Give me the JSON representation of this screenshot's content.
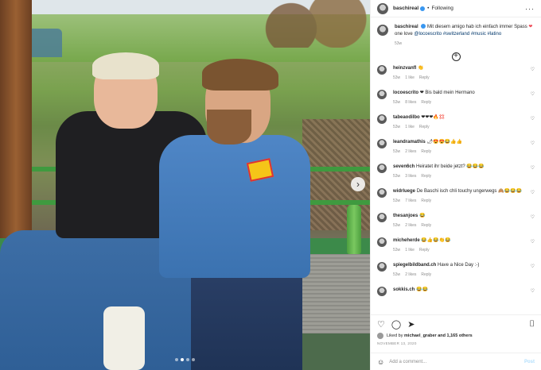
{
  "header": {
    "username": "baschireal",
    "separator": "•",
    "follow_status": "Following",
    "more_icon": "···"
  },
  "caption": {
    "username": "baschireal",
    "text_1": "Mit diesem amigo hab ich einfach immer Spass",
    "heart": "❤",
    "text_2": "one love",
    "mention": "@locoescrito",
    "hashtags": "#switzerland #music #latino",
    "time": "53w"
  },
  "load_more_icon": "+",
  "comments": [
    {
      "user": "heinzvanfl",
      "text": "👏",
      "time": "53w",
      "likes": "1 like",
      "reply": "Reply"
    },
    {
      "user": "locoescrito",
      "text": "❤ Bis bald mein Hermano",
      "time": "53w",
      "likes": "8 likes",
      "reply": "Reply"
    },
    {
      "user": "tabeaodilbo",
      "text": "❤❤❤🔥💢",
      "time": "53w",
      "likes": "1 like",
      "reply": "Reply"
    },
    {
      "user": "leandramathis",
      "text": "🌶😍😍😂👍👍",
      "time": "53w",
      "likes": "2 likes",
      "reply": "Reply"
    },
    {
      "user": "seven6ch",
      "text": "Heiratet ihr beide jetzt? 😂😂😂",
      "time": "53w",
      "likes": "3 likes",
      "reply": "Reply"
    },
    {
      "user": "widrluege",
      "text": "De Baschi isch chli touchy ungerwegs 🙈😂😂😂",
      "time": "53w",
      "likes": "7 likes",
      "reply": "Reply"
    },
    {
      "user": "thesanjoes",
      "text": "😂",
      "time": "53w",
      "likes": "2 likes",
      "reply": "Reply"
    },
    {
      "user": "micheherde",
      "text": "😂👍😂👏😂",
      "time": "53w",
      "likes": "1 like",
      "reply": "Reply"
    },
    {
      "user": "spiegelbildband.ch",
      "text": "Have a Nice Day :-)",
      "time": "53w",
      "likes": "2 likes",
      "reply": "Reply"
    },
    {
      "user": "sokkis.ch",
      "text": "😂😂",
      "time": "",
      "likes": "",
      "reply": ""
    }
  ],
  "comment_like_icon": "♡",
  "actions": {
    "like_icon": "♡",
    "comment_icon": "◯",
    "share_icon": "➤",
    "save_icon": "⌷",
    "liked_by_prefix": "Liked by",
    "liked_by_user": "michael_graber",
    "liked_by_suffix": "and 1,165 others",
    "date": "NOVEMBER 13, 2020"
  },
  "add_comment": {
    "emoji_icon": "☺",
    "placeholder": "Add a comment...",
    "post_label": "Post"
  },
  "carousel": {
    "next_icon": "›",
    "dots": 4,
    "active_dot": 1
  },
  "colors": {
    "verified": "#3897f0",
    "heart": "#ed4956",
    "link": "#00376b",
    "muted": "#8e8e8e",
    "post_disabled": "#b2dffc"
  }
}
